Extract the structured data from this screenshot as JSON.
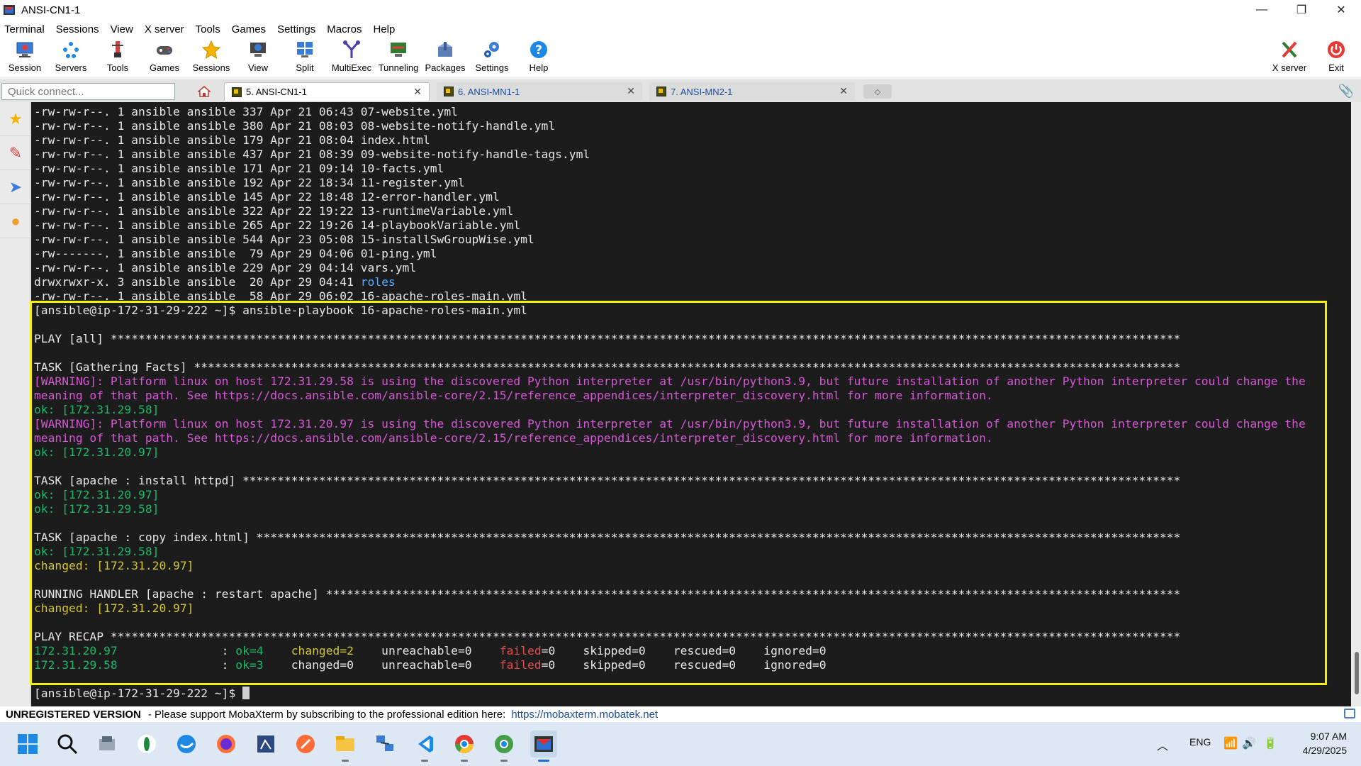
{
  "window": {
    "title": "ANSI-CN1-1"
  },
  "window_controls": {
    "minimize": "—",
    "restore": "❐",
    "close": "✕"
  },
  "menu": [
    "Terminal",
    "Sessions",
    "View",
    "X server",
    "Tools",
    "Games",
    "Settings",
    "Macros",
    "Help"
  ],
  "toolbar": {
    "items": [
      {
        "label": "Session",
        "icon": "session-icon"
      },
      {
        "label": "Servers",
        "icon": "servers-icon"
      },
      {
        "label": "Tools",
        "icon": "tools-icon"
      },
      {
        "label": "Games",
        "icon": "games-icon"
      },
      {
        "label": "Sessions",
        "icon": "star-icon"
      },
      {
        "label": "View",
        "icon": "view-icon"
      },
      {
        "label": "Split",
        "icon": "split-icon"
      },
      {
        "label": "MultiExec",
        "icon": "multiexec-icon"
      },
      {
        "label": "Tunneling",
        "icon": "tunneling-icon"
      },
      {
        "label": "Packages",
        "icon": "packages-icon"
      },
      {
        "label": "Settings",
        "icon": "settings-icon"
      },
      {
        "label": "Help",
        "icon": "help-icon"
      }
    ],
    "xserver_label": "X server",
    "exit_label": "Exit"
  },
  "quick_connect": {
    "placeholder": "Quick connect..."
  },
  "tabs": [
    {
      "label": "5. ANSI-CN1-1",
      "active": true
    },
    {
      "label": "6. ANSI-MN1-1",
      "active": false
    },
    {
      "label": "7. ANSI-MN2-1",
      "active": false
    }
  ],
  "terminal": {
    "lines": [
      [
        [
          "-rw-rw-r--. 1 ansible ansible 337 Apr 21 06:43 07-website.yml",
          "w"
        ]
      ],
      [
        [
          "-rw-rw-r--. 1 ansible ansible 380 Apr 21 08:03 08-website-notify-handle.yml",
          "w"
        ]
      ],
      [
        [
          "-rw-rw-r--. 1 ansible ansible 179 Apr 21 08:04 index.html",
          "w"
        ]
      ],
      [
        [
          "-rw-rw-r--. 1 ansible ansible 437 Apr 21 08:39 09-website-notify-handle-tags.yml",
          "w"
        ]
      ],
      [
        [
          "-rw-rw-r--. 1 ansible ansible 171 Apr 21 09:14 10-facts.yml",
          "w"
        ]
      ],
      [
        [
          "-rw-rw-r--. 1 ansible ansible 192 Apr 22 18:34 11-register.yml",
          "w"
        ]
      ],
      [
        [
          "-rw-rw-r--. 1 ansible ansible 145 Apr 22 18:48 12-error-handler.yml",
          "w"
        ]
      ],
      [
        [
          "-rw-rw-r--. 1 ansible ansible 322 Apr 22 19:22 13-runtimeVariable.yml",
          "w"
        ]
      ],
      [
        [
          "-rw-rw-r--. 1 ansible ansible 265 Apr 22 19:26 14-playbookVariable.yml",
          "w"
        ]
      ],
      [
        [
          "-rw-rw-r--. 1 ansible ansible 544 Apr 23 05:08 15-installSwGroupWise.yml",
          "w"
        ]
      ],
      [
        [
          "-rw-------. 1 ansible ansible  79 Apr 29 04:06 01-ping.yml",
          "w"
        ]
      ],
      [
        [
          "-rw-rw-r--. 1 ansible ansible 229 Apr 29 04:14 vars.yml",
          "w"
        ]
      ],
      [
        [
          "drwxrwxr-x. 3 ansible ansible  20 Apr 29 04:41 ",
          "w"
        ],
        [
          "roles",
          "b"
        ]
      ],
      [
        [
          "-rw-rw-r--. 1 ansible ansible  58 Apr 29 06:02 16-apache-roles-main.yml",
          "w"
        ]
      ],
      [
        [
          "[ansible@ip-172-31-29-222 ~]$ ansible-playbook 16-apache-roles-main.yml",
          "w"
        ]
      ],
      [
        [
          "",
          "w"
        ]
      ],
      [
        [
          "PLAY [all] **********************************************************************************************************************************************************",
          "w"
        ]
      ],
      [
        [
          "",
          "w"
        ]
      ],
      [
        [
          "TASK [Gathering Facts] **********************************************************************************************************************************************",
          "w"
        ]
      ],
      [
        [
          "[WARNING]: Platform linux on host 172.31.29.58 is using the discovered Python interpreter at /usr/bin/python3.9, but future installation of another Python interpreter could change the",
          "m"
        ]
      ],
      [
        [
          "meaning of that path. See https://docs.ansible.com/ansible-core/2.15/reference_appendices/interpreter_discovery.html for more information.",
          "m"
        ]
      ],
      [
        [
          "ok: [172.31.29.58]",
          "g"
        ]
      ],
      [
        [
          "[WARNING]: Platform linux on host 172.31.20.97 is using the discovered Python interpreter at /usr/bin/python3.9, but future installation of another Python interpreter could change the",
          "m"
        ]
      ],
      [
        [
          "meaning of that path. See https://docs.ansible.com/ansible-core/2.15/reference_appendices/interpreter_discovery.html for more information.",
          "m"
        ]
      ],
      [
        [
          "ok: [172.31.20.97]",
          "g"
        ]
      ],
      [
        [
          "",
          "w"
        ]
      ],
      [
        [
          "TASK [apache : install httpd] ***************************************************************************************************************************************",
          "w"
        ]
      ],
      [
        [
          "ok: [172.31.20.97]",
          "g"
        ]
      ],
      [
        [
          "ok: [172.31.29.58]",
          "g"
        ]
      ],
      [
        [
          "",
          "w"
        ]
      ],
      [
        [
          "TASK [apache : copy index.html] *************************************************************************************************************************************",
          "w"
        ]
      ],
      [
        [
          "ok: [172.31.29.58]",
          "g"
        ]
      ],
      [
        [
          "changed: [172.31.20.97]",
          "y"
        ]
      ],
      [
        [
          "",
          "w"
        ]
      ],
      [
        [
          "RUNNING HANDLER [apache : restart apache] ***************************************************************************************************************************",
          "w"
        ]
      ],
      [
        [
          "changed: [172.31.20.97]",
          "y"
        ]
      ],
      [
        [
          "",
          "w"
        ]
      ],
      [
        [
          "PLAY RECAP **********************************************************************************************************************************************************",
          "w"
        ]
      ],
      [
        [
          "172.31.20.97",
          "g"
        ],
        [
          "               : ",
          "w"
        ],
        [
          "ok=4",
          "g"
        ],
        [
          "    ",
          "w"
        ],
        [
          "changed=2",
          "y"
        ],
        [
          "    unreachable=0    ",
          "w"
        ],
        [
          "failed",
          "r"
        ],
        [
          "=0    skipped=0    rescued=0    ignored=0",
          "w"
        ]
      ],
      [
        [
          "172.31.29.58",
          "g"
        ],
        [
          "               : ",
          "w"
        ],
        [
          "ok=3",
          "g"
        ],
        [
          "    changed=0    unreachable=0    ",
          "w"
        ],
        [
          "failed",
          "r"
        ],
        [
          "=0    skipped=0    rescued=0    ignored=0",
          "w"
        ]
      ],
      [
        [
          "",
          "w"
        ]
      ],
      [
        [
          "[ansible@ip-172-31-29-222 ~]$ ",
          "w"
        ]
      ]
    ]
  },
  "statusbar": {
    "unregistered": "UNREGISTERED VERSION",
    "message": "-  Please support MobaXterm by subscribing to the professional edition here:",
    "link": "https://mobaxterm.mobatek.net"
  },
  "taskbar": {
    "language": "ENG",
    "time": "9:07 AM",
    "date": "4/29/2025"
  },
  "colors": {
    "terminal_bg": "#1c1c1c",
    "ok_green": "#18b868",
    "changed_yellow": "#d3c534",
    "warning_magenta": "#d657d6",
    "failed_red": "#e84a4a",
    "highlight_border": "#f2ef0b"
  }
}
